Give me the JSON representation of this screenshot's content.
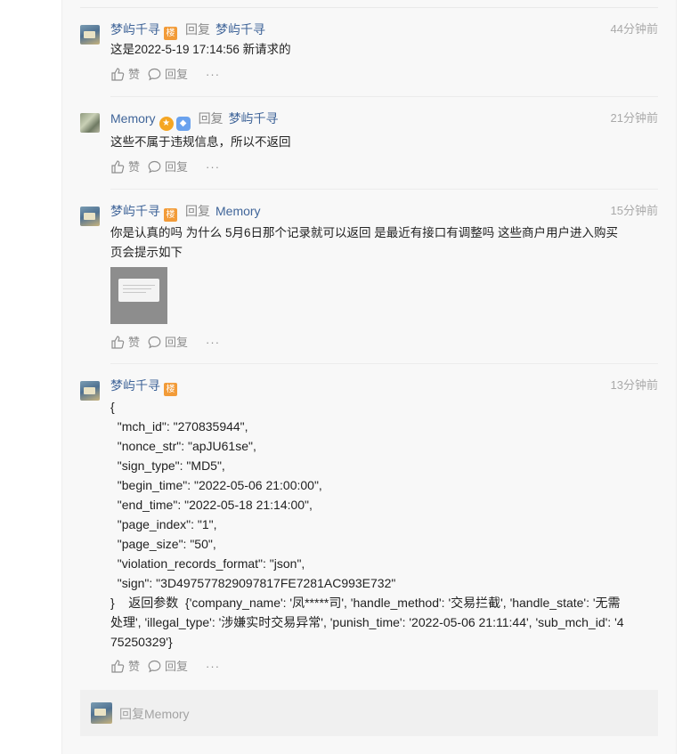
{
  "comments": [
    {
      "user": "梦屿千寻",
      "badge": "楼",
      "reply_word": "回复",
      "reply_to": "梦屿千寻",
      "time": "44分钟前",
      "text": "这是2022-5-19 17:14:56 新请求的",
      "like_label": "赞",
      "reply_label": "回复",
      "more": "···"
    },
    {
      "user": "Memory",
      "reply_word": "回复",
      "reply_to": "梦屿千寻",
      "time": "21分钟前",
      "text": "这些不属于违规信息，所以不返回",
      "like_label": "赞",
      "reply_label": "回复",
      "more": "···"
    },
    {
      "user": "梦屿千寻",
      "badge": "楼",
      "reply_word": "回复",
      "reply_to": "Memory",
      "time": "15分钟前",
      "text_line1": "你是认真的吗  为什么 5月6日那个记录就可以返回   是最近有接口有调整吗   这些商户用户进入购买",
      "text_line2": "页会提示如下",
      "like_label": "赞",
      "reply_label": "回复",
      "more": "···"
    },
    {
      "user": "梦屿千寻",
      "badge": "楼",
      "time": "13分钟前",
      "code_lines": [
        "{",
        "  \"mch_id\": \"270835944\",",
        "  \"nonce_str\": \"apJU61se\",",
        "  \"sign_type\": \"MD5\",",
        "  \"begin_time\": \"2022-05-06 21:00:00\",",
        "  \"end_time\": \"2022-05-18 21:14:00\",",
        "  \"page_index\": \"1\",",
        "  \"page_size\": \"50\",",
        "  \"violation_records_format\": \"json\",",
        "  \"sign\": \"3D497577829097817FE7281AC993E732\"",
        "}    返回参数  {'company_name': '凤*****司', 'handle_method': '交易拦截', 'handle_state': '无需",
        "处理', 'illegal_type': '涉嫌实时交易异常', 'punish_time': '2022-05-06 21:11:44', 'sub_mch_id': '4",
        "75250329'}"
      ],
      "like_label": "赞",
      "reply_label": "回复",
      "more": "···"
    }
  ],
  "reply_box": {
    "placeholder": "回复Memory"
  }
}
